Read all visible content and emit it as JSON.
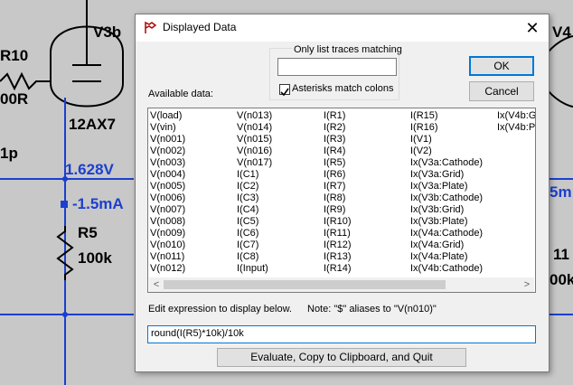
{
  "schematic": {
    "labels": {
      "v3b": "V3b",
      "r10": "R10",
      "r10_value": "00R",
      "tube": "12AX7",
      "cap": "1p",
      "voltage": "1.628V",
      "current": "-1.5mA",
      "r5": "R5",
      "r5_value": "100k",
      "v4_partial": "V4",
      "current_right": "5m",
      "right_11": "11",
      "right_00k": "00k"
    },
    "colors": {
      "wire": "#1b3fcf",
      "background": "#c8c8c8"
    }
  },
  "dialog": {
    "title": "Displayed Data",
    "close_glyph": "✕",
    "filter_group_label": "Only list traces matching",
    "filter_value": "",
    "asterisks_label": "Asterisks match colons",
    "asterisks_checked": true,
    "available_label": "Available data:",
    "ok_label": "OK",
    "cancel_label": "Cancel",
    "edit_label": "Edit expression to display below.",
    "note": "Note: \"$\" aliases to \"V(n010)\"",
    "expression": "round(I(R5)*10k)/10k",
    "evaluate_label": "Evaluate, Copy to Clipboard, and Quit",
    "traces": [
      [
        "V(load)",
        "V(vin)",
        "V(n001)",
        "V(n002)",
        "V(n003)",
        "V(n004)",
        "V(n005)",
        "V(n006)",
        "V(n007)",
        "V(n008)",
        "V(n009)",
        "V(n010)",
        "V(n011)",
        "V(n012)"
      ],
      [
        "V(n013)",
        "V(n014)",
        "V(n015)",
        "V(n016)",
        "V(n017)",
        "I(C1)",
        "I(C2)",
        "I(C3)",
        "I(C4)",
        "I(C5)",
        "I(C6)",
        "I(C7)",
        "I(C8)",
        "I(Input)"
      ],
      [
        "I(R1)",
        "I(R2)",
        "I(R3)",
        "I(R4)",
        "I(R5)",
        "I(R6)",
        "I(R7)",
        "I(R8)",
        "I(R9)",
        "I(R10)",
        "I(R11)",
        "I(R12)",
        "I(R13)",
        "I(R14)"
      ],
      [
        "I(R15)",
        "I(R16)",
        "I(V1)",
        "I(V2)",
        "Ix(V3a:Cathode)",
        "Ix(V3a:Grid)",
        "Ix(V3a:Plate)",
        "Ix(V3b:Cathode)",
        "Ix(V3b:Grid)",
        "Ix(V3b:Plate)",
        "Ix(V4a:Cathode)",
        "Ix(V4a:Grid)",
        "Ix(V4a:Plate)",
        "Ix(V4b:Cathode)"
      ],
      [
        "Ix(V4b:G",
        "Ix(V4b:Pl"
      ]
    ]
  }
}
